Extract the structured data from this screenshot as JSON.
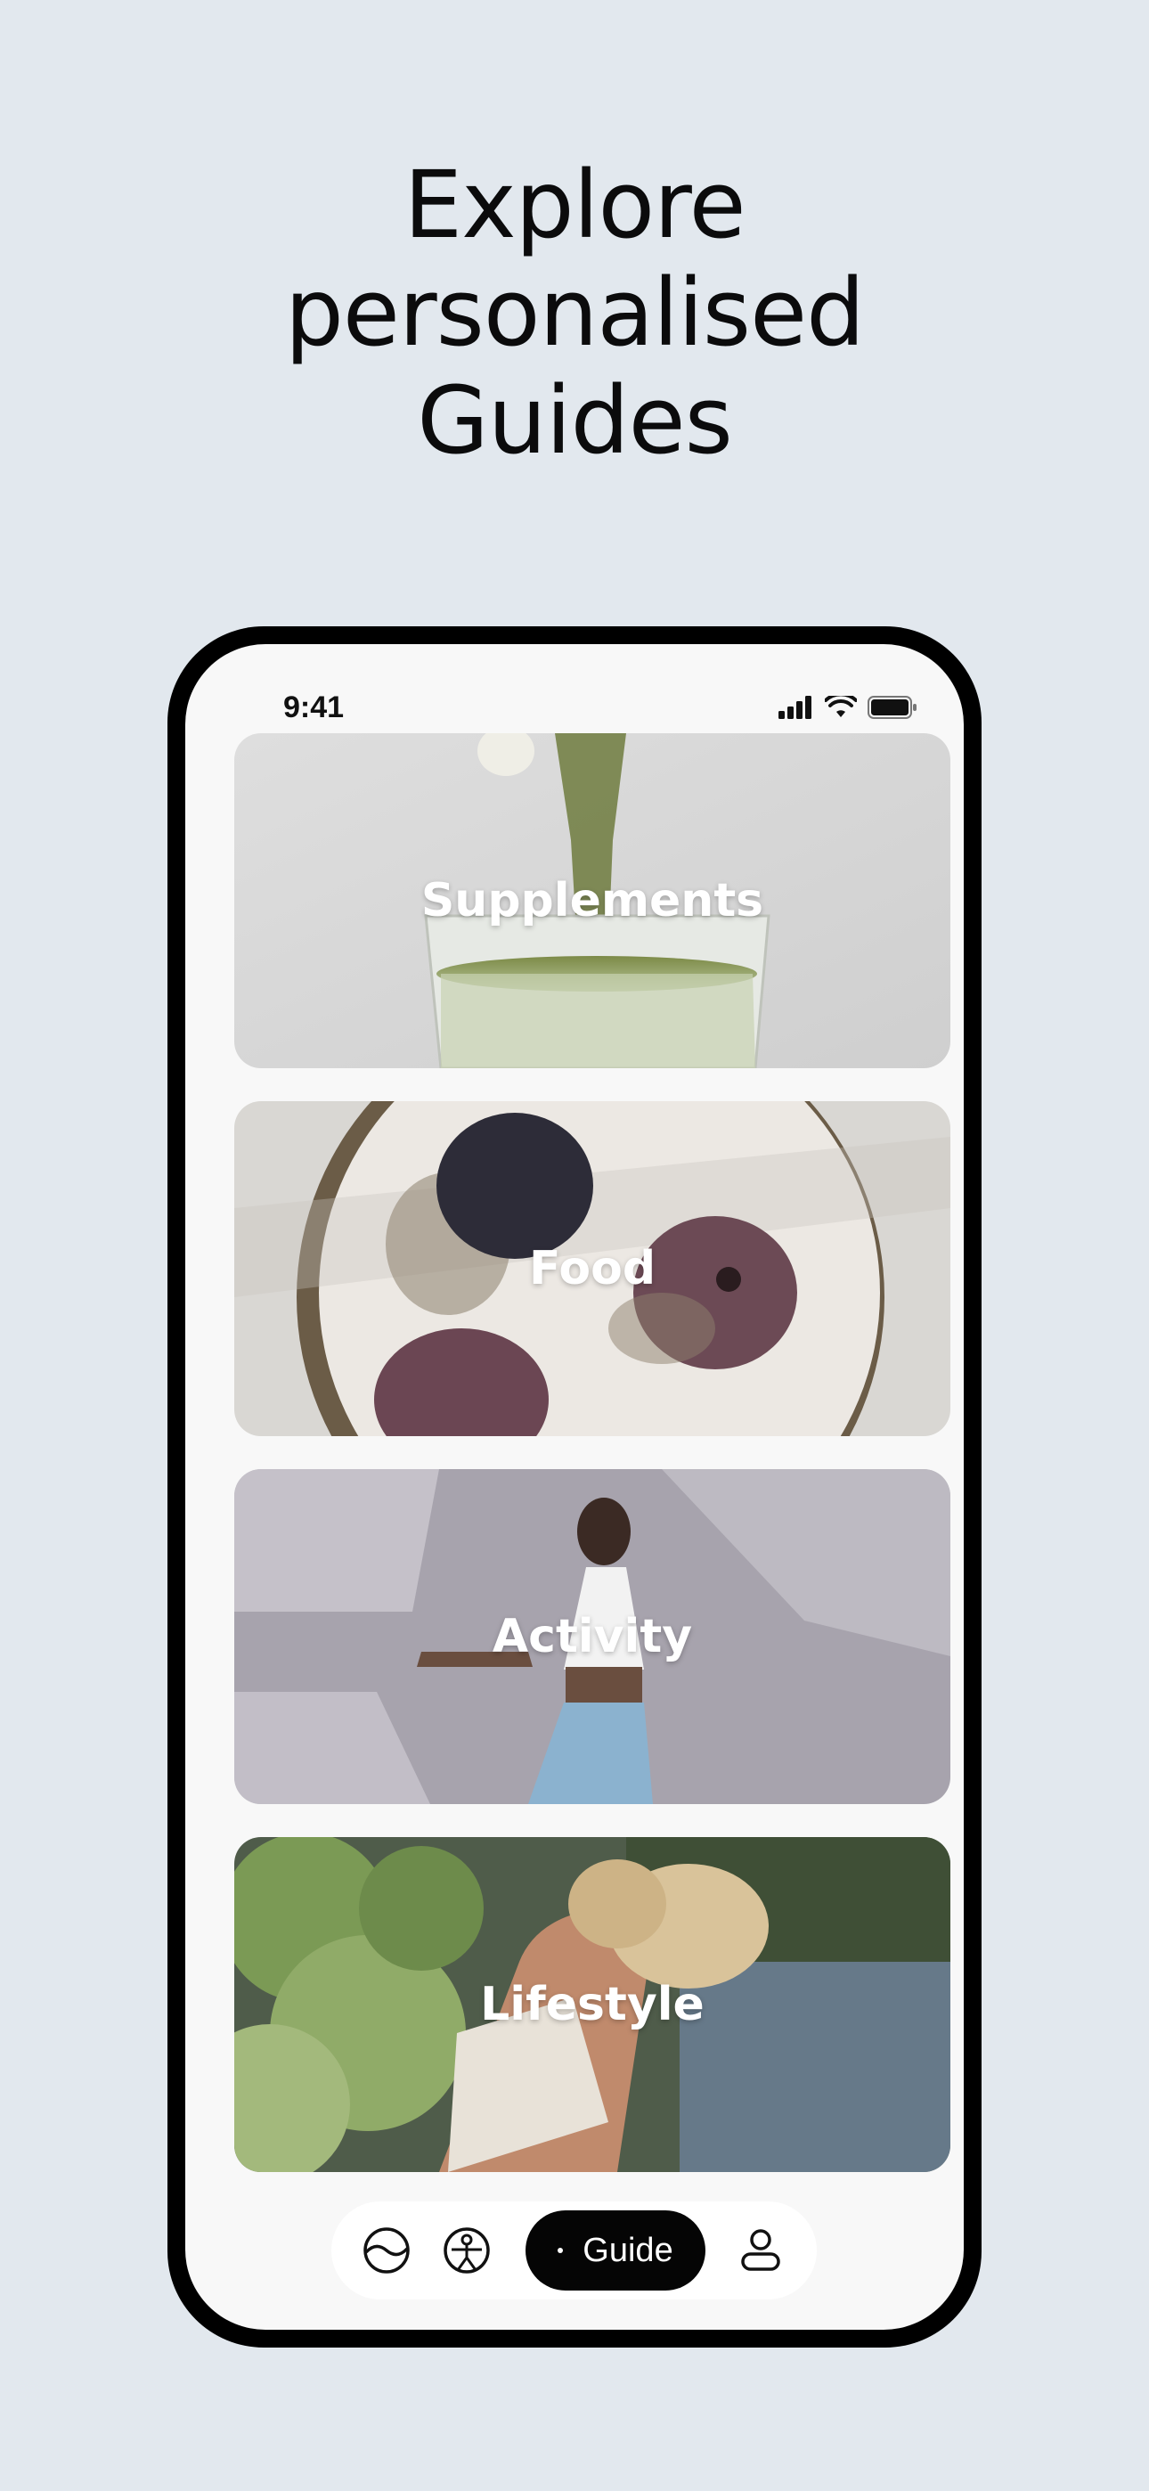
{
  "headline": {
    "line1": "Explore",
    "line2": "personalised",
    "line3": "Guides"
  },
  "status_bar": {
    "time": "9:41"
  },
  "cards": [
    {
      "label": "Supplements"
    },
    {
      "label": "Food"
    },
    {
      "label": "Activity"
    },
    {
      "label": "Lifestyle"
    }
  ],
  "tab_bar": {
    "tabs": [
      {
        "icon": "wave-icon"
      },
      {
        "icon": "body-icon"
      },
      {
        "icon": "guide-icon",
        "label": "Guide",
        "active": true
      },
      {
        "icon": "profile-icon"
      }
    ]
  }
}
